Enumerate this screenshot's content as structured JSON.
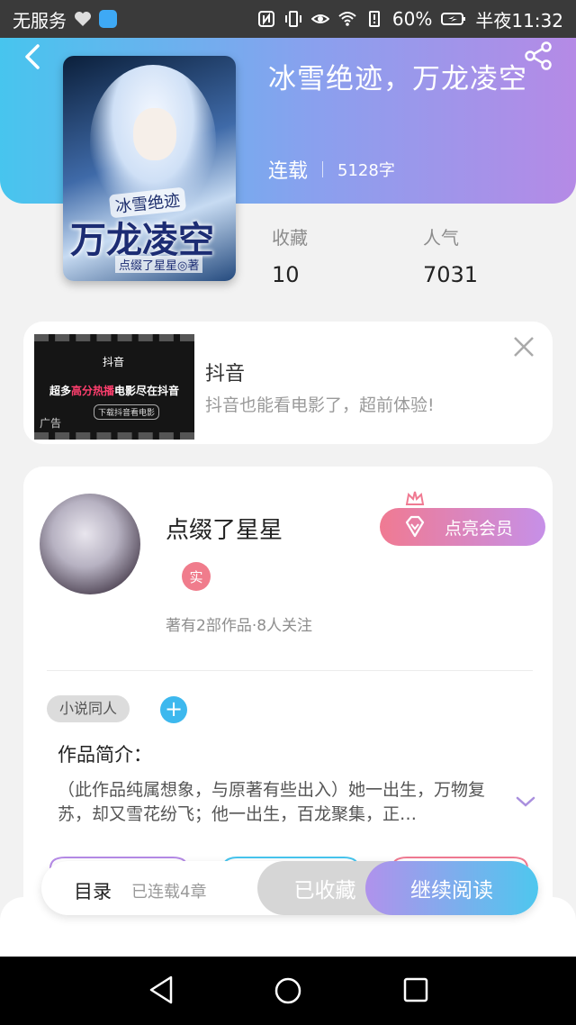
{
  "status_bar": {
    "carrier": "无服务",
    "battery": "60%",
    "time": "半夜11:32",
    "icons": [
      "heart-icon",
      "app-icon",
      "nfc-icon",
      "vibrate-icon",
      "eye-icon",
      "wifi-icon",
      "battery-alert-icon",
      "battery-icon"
    ]
  },
  "header": {
    "book_title": "冰雪绝迹，万龙凌空",
    "status": "连载",
    "word_count": "5128字",
    "colors": {
      "start": "#47c5ee",
      "end": "#b58ae6"
    }
  },
  "cover": {
    "title_small": "冰雪绝迹",
    "title_big": "万龙凌空",
    "author_line": "点缀了星星◎著"
  },
  "stats": {
    "favorites_label": "收藏",
    "favorites_value": "10",
    "popularity_label": "人气",
    "popularity_value": "7031"
  },
  "ad": {
    "title": "抖音",
    "desc": "抖音也能看电影了，超前体验!",
    "img_brand": "抖音",
    "img_banner_pre": "超多",
    "img_banner_hl": "高分热播",
    "img_banner_post": "电影尽在抖音",
    "img_button": "下载抖音看电影",
    "img_tag": "广告"
  },
  "author": {
    "name": "点缀了星星",
    "vip_button": "点亮会员",
    "real_badge": "实",
    "meta": "著有2部作品·8人关注",
    "tag": "小说同人",
    "tag_add": "+",
    "intro_label": "作品简介：",
    "intro_text": "（此作品纯属想象，与原著有些出入）她一出生，万物复苏，却又雪花纷飞；他一出生，百龙聚集，正…"
  },
  "bottom_bar": {
    "catalog": "目录",
    "catalog_sub": "已连载4章",
    "collected": "已收藏",
    "continue_reading": "继续阅读"
  }
}
